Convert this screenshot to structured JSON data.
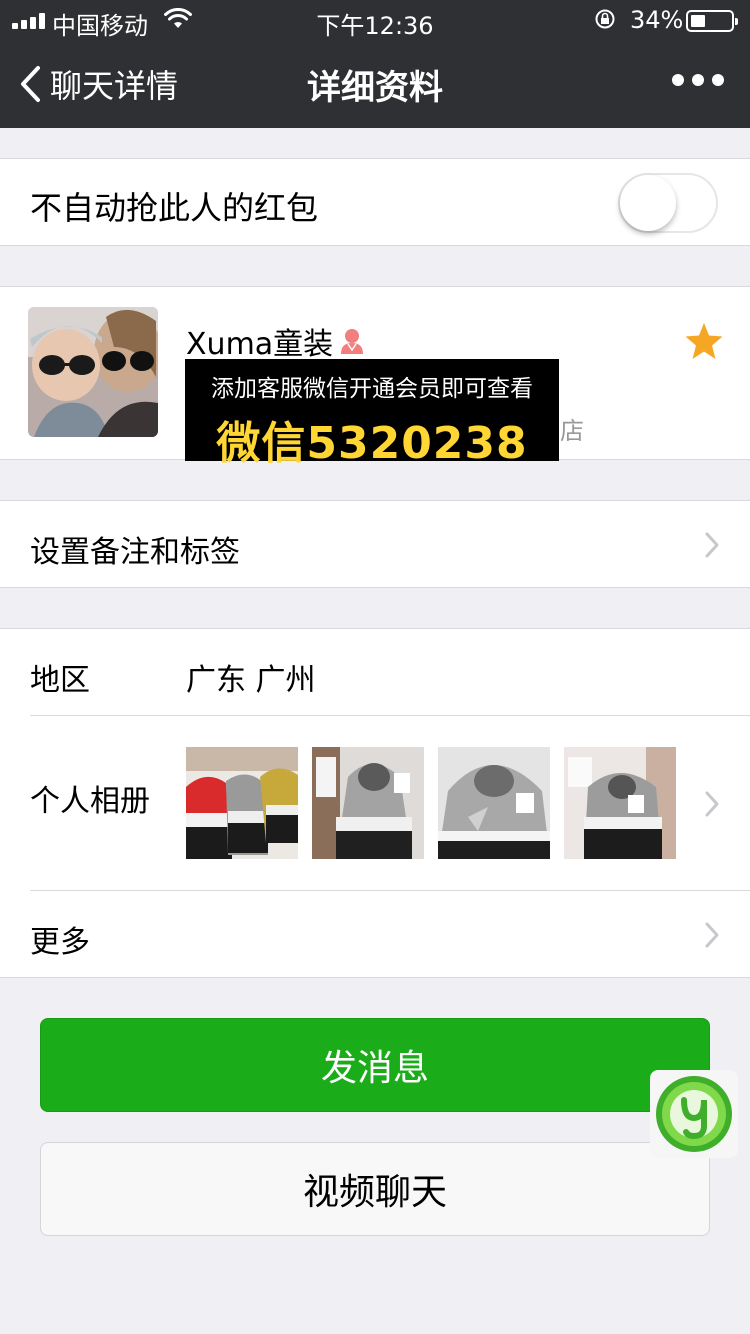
{
  "status_bar": {
    "carrier": "中国移动",
    "time": "下午12:36",
    "battery": "34%",
    "battery_level": 0.34
  },
  "nav": {
    "back_label": "聊天详情",
    "title": "详细资料"
  },
  "red_packet_setting": {
    "label": "不自动抢此人的红包",
    "enabled": false
  },
  "profile": {
    "name": "Xuma童装",
    "gender": "female",
    "starred": true,
    "overlay_line1": "添加客服微信开通会员即可查看",
    "overlay_line2": "微信5320238",
    "partial_suffix": "店"
  },
  "remark_cell": {
    "label": "设置备注和标签"
  },
  "region": {
    "label": "地区",
    "value": "广东 广州"
  },
  "album": {
    "label": "个人相册",
    "photo_count": 4
  },
  "more_cell": {
    "label": "更多"
  },
  "buttons": {
    "message": "发消息",
    "video": "视频聊天"
  },
  "colors": {
    "nav_bg": "#2e3033",
    "accent_green": "#1aad19",
    "star": "#f5a623",
    "page_bg": "#efeff4"
  }
}
